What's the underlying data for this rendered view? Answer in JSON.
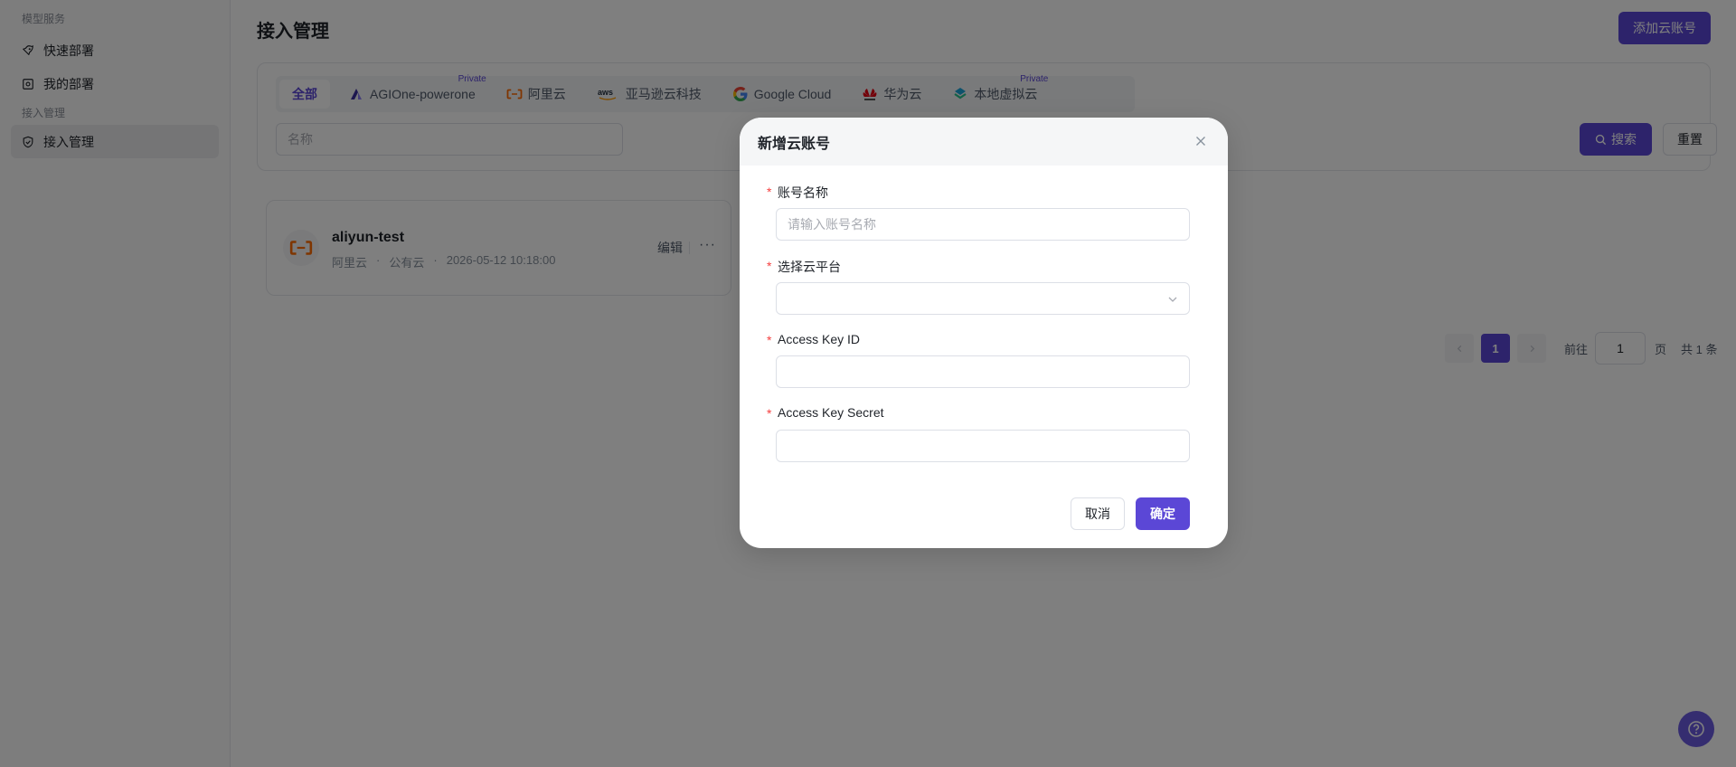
{
  "sidebar": {
    "group1": "模型服务",
    "items": [
      {
        "label": "快速部署",
        "icon": "rocket-icon"
      },
      {
        "label": "我的部署",
        "icon": "deploy-icon"
      }
    ],
    "group2": "接入管理",
    "active_item": {
      "label": "接入管理",
      "icon": "shield-icon"
    }
  },
  "page": {
    "title": "接入管理",
    "add_button": "添加云账号"
  },
  "filter": {
    "tabs": [
      {
        "label": "全部",
        "active": true
      },
      {
        "label": "AGIOne-powerone",
        "badge": "Private",
        "icon": "agione-logo-icon"
      },
      {
        "label": "阿里云",
        "icon": "aliyun-logo-icon"
      },
      {
        "label": "亚马逊云科技",
        "icon": "aws-logo-icon"
      },
      {
        "label": "Google Cloud",
        "icon": "google-logo-icon"
      },
      {
        "label": "华为云",
        "icon": "huawei-logo-icon"
      },
      {
        "label": "本地虚拟云",
        "badge": "Private",
        "icon": "local-cloud-logo-icon"
      }
    ],
    "name_placeholder": "名称",
    "search_button": "搜索",
    "reset_button": "重置"
  },
  "accounts": [
    {
      "name": "aliyun-test",
      "platform": "阿里云",
      "cloud_type": "公有云",
      "created": "2026-05-12 10:18:00",
      "edit_label": "编辑",
      "more_label": "···"
    }
  ],
  "pagination": {
    "current_page": "1",
    "goto_label": "前往",
    "goto_value": "1",
    "page_unit": "页",
    "total": "共 1 条"
  },
  "modal": {
    "title": "新增云账号",
    "fields": [
      {
        "label": "账号名称",
        "placeholder": "请输入账号名称",
        "value": ""
      },
      {
        "label": "选择云平台",
        "value": ""
      },
      {
        "label": "Access Key ID",
        "value": ""
      },
      {
        "label": "Access Key Secret",
        "value": ""
      }
    ],
    "cancel_button": "取消",
    "ok_button": "确定"
  },
  "colors": {
    "accent": "#5b47d6",
    "aliyun": "#ff6a00",
    "required": "#f53f3f"
  }
}
